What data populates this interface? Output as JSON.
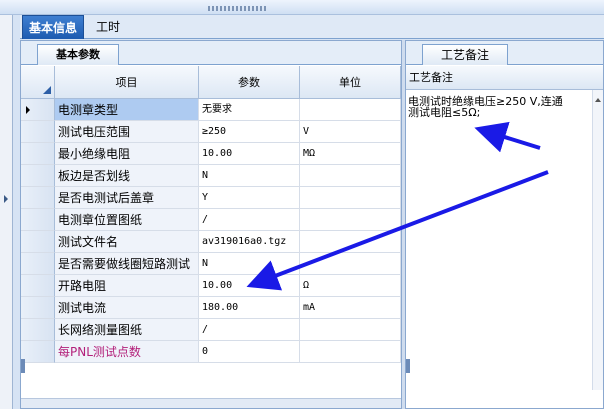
{
  "top_tabs": [
    {
      "label": "基本信息",
      "active": true
    },
    {
      "label": "工时",
      "active": false
    }
  ],
  "left_subtab": {
    "label": "基本参数"
  },
  "grid": {
    "headers": [
      "项目",
      "参数",
      "单位"
    ],
    "rows": [
      {
        "item": "电测章类型",
        "value": "无要求",
        "unit": "",
        "current": true
      },
      {
        "item": "测试电压范围",
        "value": "≥250",
        "unit": "V"
      },
      {
        "item": "最小绝缘电阻",
        "value": "10.00",
        "unit": "MΩ"
      },
      {
        "item": "板边是否划线",
        "value": "N",
        "unit": ""
      },
      {
        "item": "是否电测试后盖章",
        "value": "Y",
        "unit": ""
      },
      {
        "item": "电测章位置图纸",
        "value": "/",
        "unit": ""
      },
      {
        "item": "测试文件名",
        "value": "av319016a0.tgz",
        "unit": ""
      },
      {
        "item": "是否需要做线圈短路测试",
        "value": "N",
        "unit": ""
      },
      {
        "item": "开路电阻",
        "value": "10.00",
        "unit": "Ω"
      },
      {
        "item": "测试电流",
        "value": "180.00",
        "unit": "mA"
      },
      {
        "item": "长网络测量图纸",
        "value": "/",
        "unit": ""
      },
      {
        "item": "每PNL测试点数",
        "value": "0",
        "unit": "",
        "highlight": true
      }
    ]
  },
  "right_subtab": {
    "label": "工艺备注"
  },
  "notes": {
    "header": "工艺备注",
    "line1": "电测试时绝缘电压≥250 V,连通",
    "line2": "测试电阻≤5Ω;"
  },
  "colors": {
    "annotation_arrow": "#1a1ae6",
    "active_tab": "#1d5bb0",
    "highlight_text": "#b3207a"
  }
}
